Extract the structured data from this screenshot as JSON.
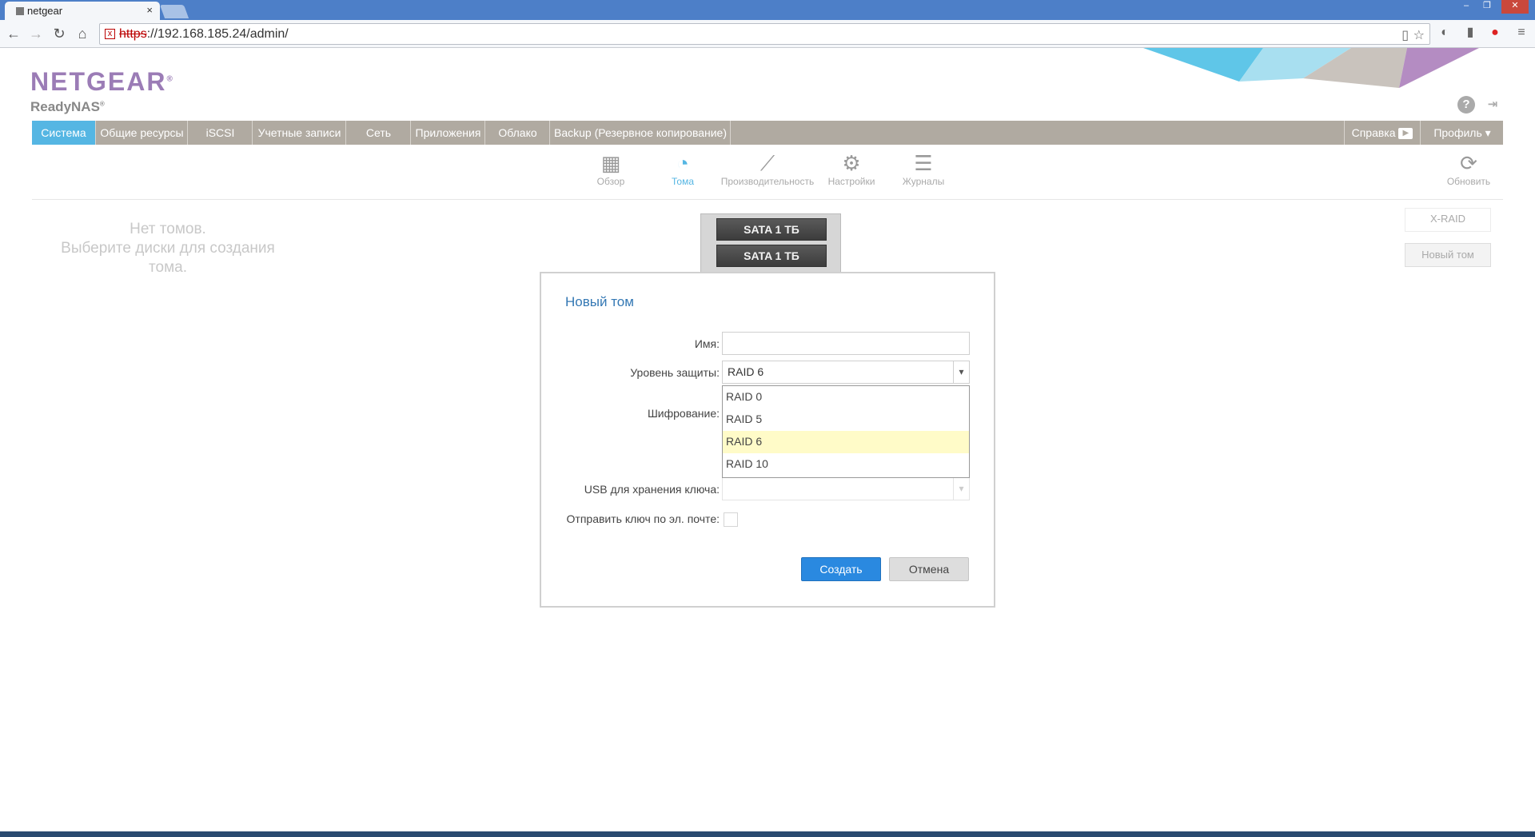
{
  "browser": {
    "tab_title": "netgear",
    "tab_close": "×",
    "url_protocol": "https",
    "url_rest": "://192.168.185.24/admin/",
    "window_controls": [
      "–",
      "❐",
      "✕"
    ]
  },
  "header": {
    "logo": "NETGEAR",
    "logo_mark": "®",
    "product": "ReadyNAS",
    "product_mark": "®",
    "help_icon": "?",
    "logout_icon": "⇥"
  },
  "menu": {
    "items": [
      "Система",
      "Общие ресурсы",
      "iSCSI",
      "Учетные записи",
      "Сеть",
      "Приложения",
      "Облако",
      "Backup (Резервное копирование)"
    ],
    "help": "Справка",
    "profile": "Профиль"
  },
  "subnav": {
    "items": [
      {
        "label": "Обзор",
        "icon": "grid-icon"
      },
      {
        "label": "Тома",
        "icon": "volume-icon"
      },
      {
        "label": "Производительность",
        "icon": "chart-icon"
      },
      {
        "label": "Настройки",
        "icon": "gear-icon"
      },
      {
        "label": "Журналы",
        "icon": "list-icon"
      }
    ],
    "refresh": "Обновить"
  },
  "volumes": {
    "empty_line1": "Нет томов.",
    "empty_line2": "Выберите диски для создания",
    "empty_line3": "тома.",
    "xraid": "X-RAID",
    "new_volume": "Новый том",
    "disks": [
      "SATA 1 ТБ",
      "SATA 1 ТБ"
    ]
  },
  "dialog": {
    "title": "Новый том",
    "name_label": "Имя:",
    "name_value": "",
    "protection_label": "Уровень защиты:",
    "protection_value": "RAID 6",
    "protection_options": [
      "RAID 0",
      "RAID 5",
      "RAID 6",
      "RAID 10"
    ],
    "encryption_label": "Шифрование:",
    "usb_label": "USB для хранения ключа:",
    "email_label": "Отправить ключ по эл. почте:",
    "create": "Создать",
    "cancel": "Отмена"
  },
  "colors": {
    "accent": "#55b6e3",
    "menubar": "#b0aaa1",
    "logo": "#9b7cb6",
    "primary_button": "#2a89e0",
    "selected_option": "#fffbc8"
  }
}
